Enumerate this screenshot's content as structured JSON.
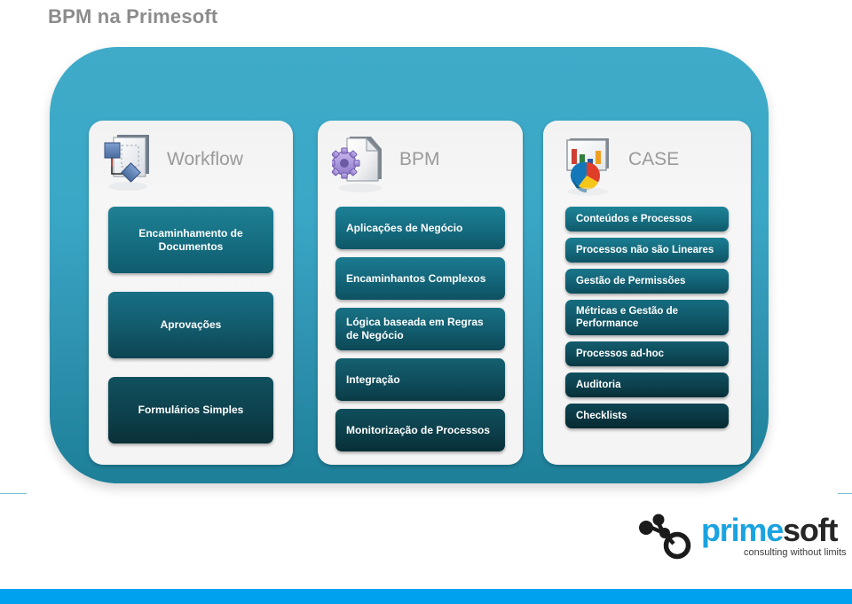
{
  "slide": {
    "title": "BPM na Primesoft",
    "accent_teal": "#2d90ad",
    "accent_blue": "#00a2f0",
    "box_teal_light": "#1a7c8e",
    "box_teal_dark": "#123c42",
    "title_color": "#8c8c8c"
  },
  "columns": [
    {
      "id": "workflow",
      "title": "Workflow",
      "icon": "workflow-diagram-icon",
      "align": "center",
      "items": [
        {
          "label": "Encaminhamento de Documentos"
        },
        {
          "label": "Aprovações"
        },
        {
          "label": "Formulários Simples"
        }
      ]
    },
    {
      "id": "bpm",
      "title": "BPM",
      "icon": "document-gear-icon",
      "align": "left",
      "items": [
        {
          "label": "Aplicações de Negócio"
        },
        {
          "label": "Encaminhantos Complexos"
        },
        {
          "label": "Lógica baseada em Regras de Negócio"
        },
        {
          "label": "Integração"
        },
        {
          "label": "Monitorização de Processos"
        }
      ]
    },
    {
      "id": "case",
      "title": "CASE",
      "icon": "chart-analytics-icon",
      "align": "left",
      "items": [
        {
          "label": "Conteúdos e Processos"
        },
        {
          "label": "Processos não são Lineares"
        },
        {
          "label": "Gestão de Permissões"
        },
        {
          "label": "Métricas e Gestão de Performance"
        },
        {
          "label": "Processos ad-hoc"
        },
        {
          "label": "Auditoria"
        },
        {
          "label": "Checklists"
        }
      ]
    }
  ],
  "logo": {
    "mark": "network-nodes-icon",
    "word_primary": "prime",
    "word_secondary": "soft",
    "tagline": "consulting without limits",
    "primary_color": "#1aa3e0"
  }
}
